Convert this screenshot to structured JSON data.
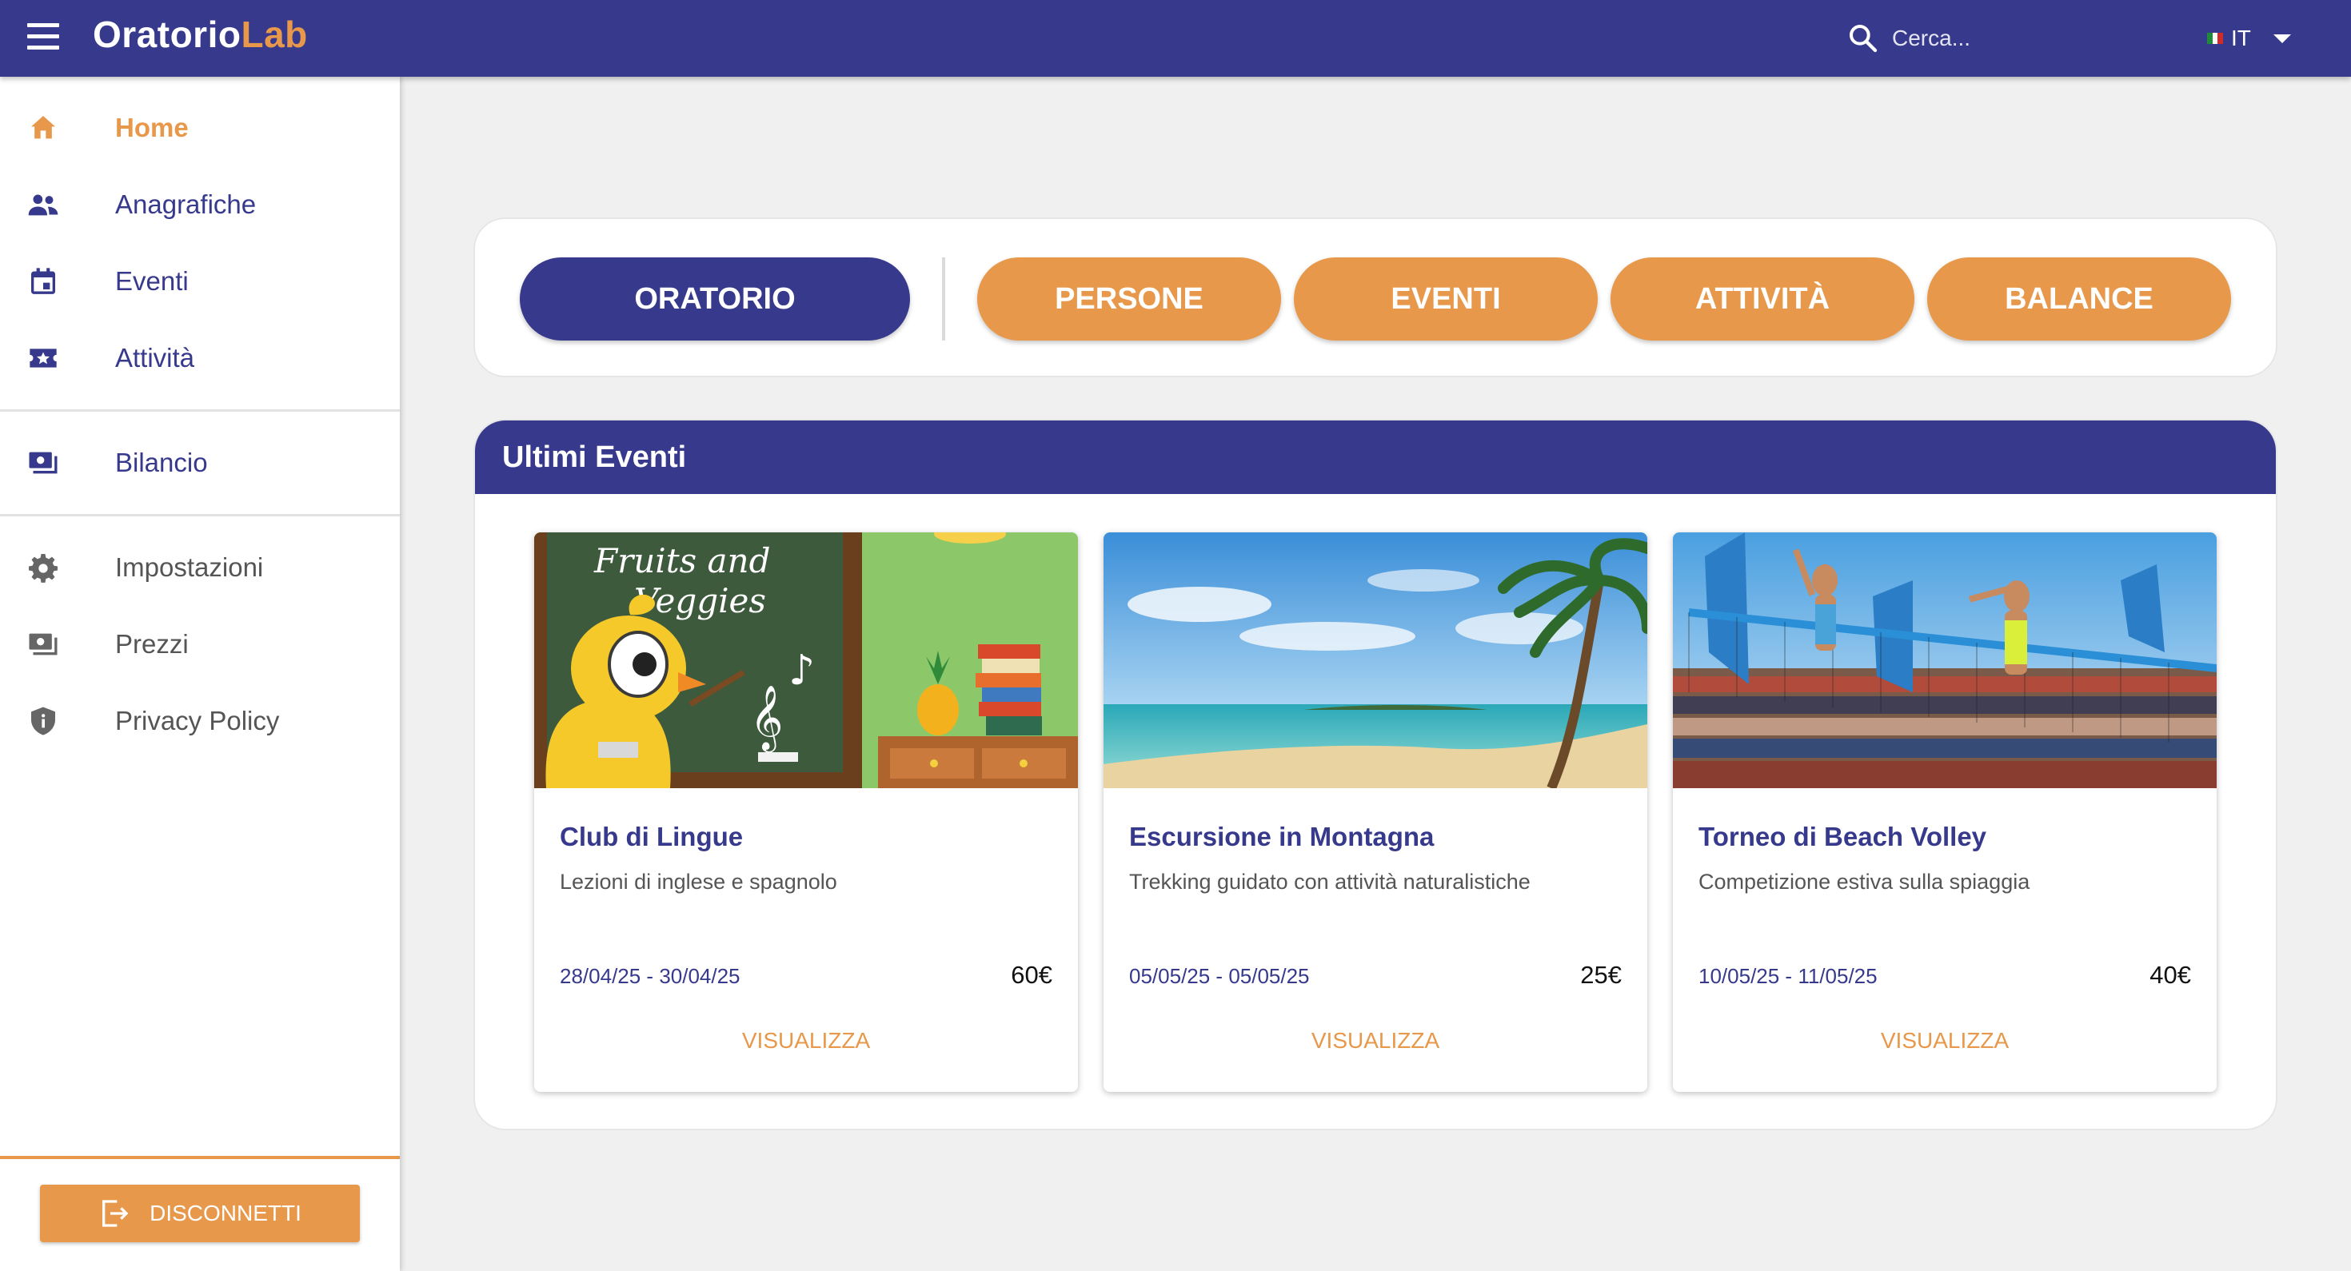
{
  "topbar": {
    "brand_part1": "Oratorio",
    "brand_part2": "Lab",
    "search_placeholder": "Cerca...",
    "language": "IT"
  },
  "sidebar": {
    "items": [
      {
        "label": "Home",
        "icon": "home-icon"
      },
      {
        "label": "Anagrafiche",
        "icon": "people-icon"
      },
      {
        "label": "Eventi",
        "icon": "calendar-icon"
      },
      {
        "label": "Attività",
        "icon": "ticket-star-icon"
      },
      {
        "label": "Bilancio",
        "icon": "money-icon"
      },
      {
        "label": "Impostazioni",
        "icon": "gear-icon"
      },
      {
        "label": "Prezzi",
        "icon": "money-icon"
      },
      {
        "label": "Privacy Policy",
        "icon": "shield-icon"
      }
    ],
    "logout_label": "DISCONNETTI"
  },
  "tabs": [
    "ORATORIO",
    "PERSONE",
    "EVENTI",
    "ATTIVITÀ",
    "BALANCE"
  ],
  "events": {
    "title": "Ultimi Eventi",
    "cards": [
      {
        "title": "Club di Lingue",
        "description": "Lezioni di inglese e spagnolo",
        "dates": "28/04/25 - 30/04/25",
        "price": "60€",
        "action": "VISUALIZZA",
        "image_text_line1": "Fruits and",
        "image_text_line2": "Veggies"
      },
      {
        "title": "Escursione in Montagna",
        "description": "Trekking guidato con attività naturalistiche",
        "dates": "05/05/25 - 05/05/25",
        "price": "25€",
        "action": "VISUALIZZA"
      },
      {
        "title": "Torneo di Beach Volley",
        "description": "Competizione estiva sulla spiaggia",
        "dates": "10/05/25 - 11/05/25",
        "price": "40€",
        "action": "VISUALIZZA"
      }
    ]
  },
  "colors": {
    "primary": "#373a8c",
    "accent": "#e8984a",
    "background": "#f0f0f0"
  }
}
